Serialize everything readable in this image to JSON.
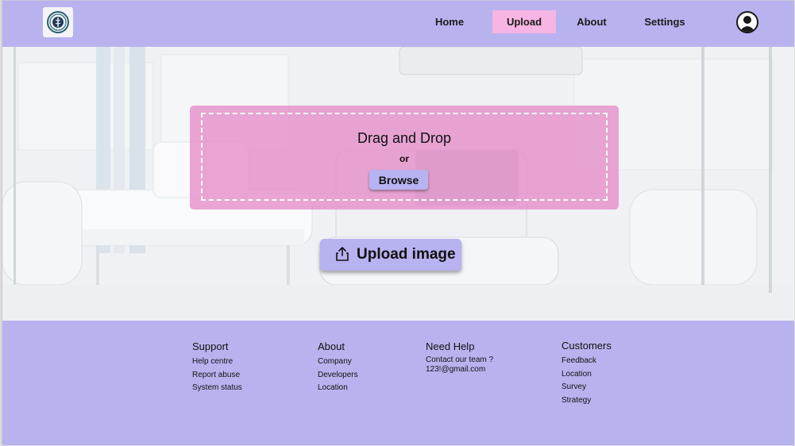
{
  "header": {
    "logo_icon": "caduceus-logo-icon",
    "nav": [
      {
        "label": "Home"
      },
      {
        "label": "Upload",
        "active": true
      },
      {
        "label": "About"
      },
      {
        "label": "Settings"
      }
    ],
    "avatar_icon": "user-avatar-icon"
  },
  "upload": {
    "title": "Drag and Drop",
    "or": "or",
    "browse_label": "Browse",
    "upload_label": "Upload image",
    "upload_icon": "upload-share-icon"
  },
  "footer": {
    "support": {
      "title": "Support",
      "links": [
        "Help centre",
        "Report abuse",
        "System status"
      ]
    },
    "about": {
      "title": "About",
      "links": [
        "Company",
        "Developers",
        "Location"
      ]
    },
    "help": {
      "title": "Need Help",
      "lines": [
        "Contact our team ?",
        "123!@gmail.com"
      ]
    },
    "customers": {
      "title": "Customers",
      "links": [
        "Feedback",
        "Location",
        "Survey",
        "Strategy"
      ]
    }
  },
  "colors": {
    "primary": "#b8b3ef",
    "accent_pink": "#f6b5e2",
    "dropzone": "#e48cc8"
  }
}
